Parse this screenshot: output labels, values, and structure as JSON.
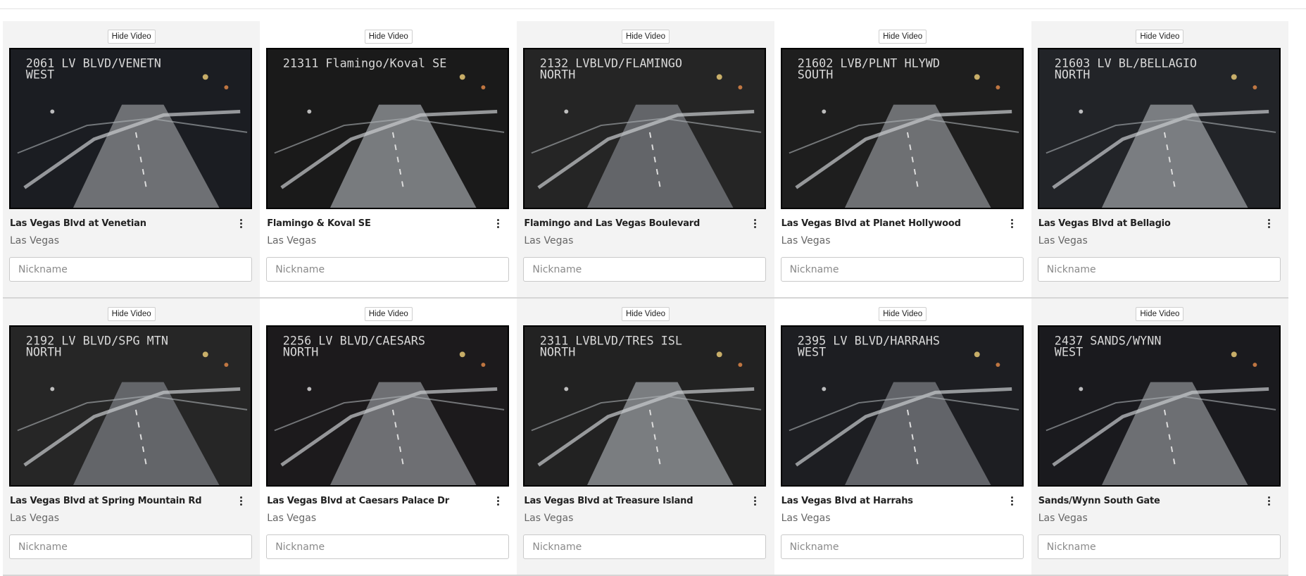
{
  "hide_video_label": "Hide Video",
  "nickname_placeholder": "Nickname",
  "cameras": [
    {
      "title": "Las Vegas Blvd at Venetian",
      "city": "Las Vegas",
      "overlay": [
        "2061 LV BLVD/VENETN",
        "WEST"
      ]
    },
    {
      "title": "Flamingo & Koval SE",
      "city": "Las Vegas",
      "overlay": [
        "21311 Flamingo/Koval SE",
        ""
      ]
    },
    {
      "title": "Flamingo and Las Vegas Boulevard",
      "city": "Las Vegas",
      "overlay": [
        "2132 LVBLVD/FLAMINGO",
        "NORTH"
      ]
    },
    {
      "title": "Las Vegas Blvd at Planet Hollywood",
      "city": "Las Vegas",
      "overlay": [
        "21602 LVB/PLNT HLYWD",
        "SOUTH"
      ]
    },
    {
      "title": "Las Vegas Blvd at Bellagio",
      "city": "Las Vegas",
      "overlay": [
        "21603 LV BL/BELLAGIO",
        "NORTH"
      ]
    },
    {
      "title": "Las Vegas Blvd at Spring Mountain Rd",
      "city": "Las Vegas",
      "overlay": [
        "2192 LV BLVD/SPG MTN",
        "NORTH"
      ]
    },
    {
      "title": "Las Vegas Blvd at Caesars Palace Dr",
      "city": "Las Vegas",
      "overlay": [
        "2256 LV BLVD/CAESARS",
        "NORTH"
      ]
    },
    {
      "title": "Las Vegas Blvd at Treasure Island",
      "city": "Las Vegas",
      "overlay": [
        "2311 LVBLVD/TRES ISL",
        "NORTH"
      ]
    },
    {
      "title": "Las Vegas Blvd at Harrahs",
      "city": "Las Vegas",
      "overlay": [
        "2395 LV BLVD/HARRAHS",
        "WEST"
      ]
    },
    {
      "title": "Sands/Wynn South Gate",
      "city": "Las Vegas",
      "overlay": [
        "2437 SANDS/WYNN",
        "WEST"
      ]
    }
  ],
  "colors": {
    "card_shade": "#f3f3f3",
    "card_plain": "#ffffff",
    "feed_background": "#1b1b1b",
    "overlay_text": "#d8d8d8"
  },
  "icons": {
    "menu": "kebab-vertical-icon"
  }
}
